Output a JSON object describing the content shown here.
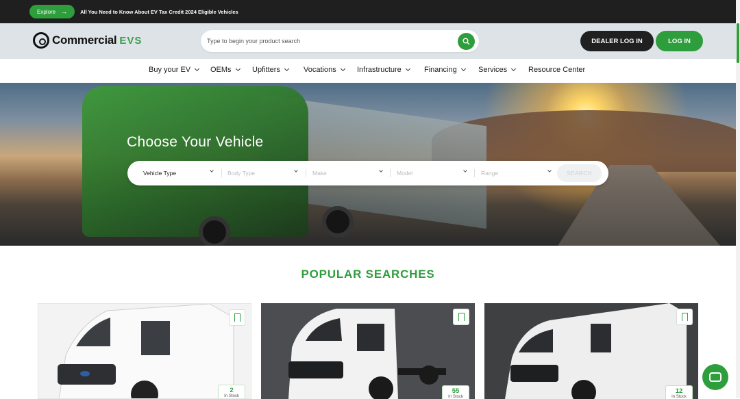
{
  "topbar": {
    "explore_label": "Explore",
    "promo_text": "All You Need to Know About EV Tax Credit 2024 Eligible Vehicles"
  },
  "header": {
    "logo_text": "Commercial",
    "logo_ev": "EVS",
    "search_placeholder": "Type to begin your product search",
    "dealer_login": "DEALER LOG IN",
    "login": "LOG IN"
  },
  "nav": {
    "items": [
      {
        "label": "Buy your EV"
      },
      {
        "label": "OEMs"
      },
      {
        "label": "Upfitters"
      },
      {
        "label": "Vocations"
      },
      {
        "label": "Infrastructure"
      },
      {
        "label": "Financing"
      },
      {
        "label": "Services"
      },
      {
        "label": "Resource Center"
      }
    ]
  },
  "hero": {
    "title": "Choose Your Vehicle",
    "filters": [
      {
        "label": "Vehicle Type"
      },
      {
        "label": "Body Type"
      },
      {
        "label": "Make"
      },
      {
        "label": "Model"
      },
      {
        "label": "Range"
      }
    ],
    "search_label": "SEARCH"
  },
  "popular": {
    "title": "POPULAR SEARCHES",
    "cards": [
      {
        "count": "2",
        "stock_label": "In Stock"
      },
      {
        "count": "55",
        "stock_label": "In Stock"
      },
      {
        "count": "12",
        "stock_label": "In Stock"
      }
    ]
  },
  "colors": {
    "brand_green": "#2e9d3c",
    "dark": "#202020"
  },
  "icons": {
    "search": "magnifier-icon",
    "bookmark": "bookmark-icon",
    "chat": "chat-icon"
  }
}
